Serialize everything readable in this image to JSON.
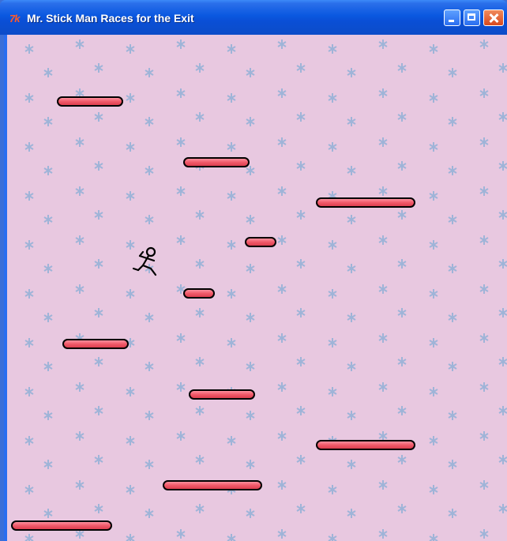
{
  "window": {
    "title": "Mr. Stick Man Races for the Exit",
    "app_icon": "tk-feather-icon",
    "controls": [
      "minimize",
      "maximize",
      "close"
    ]
  },
  "game": {
    "background_color": "#e8c8e0",
    "star_color": "#9fb4d8",
    "platform_fill": "#f06070",
    "platform_outline": "#000000",
    "platform_count": 10,
    "player": "stick-man"
  }
}
